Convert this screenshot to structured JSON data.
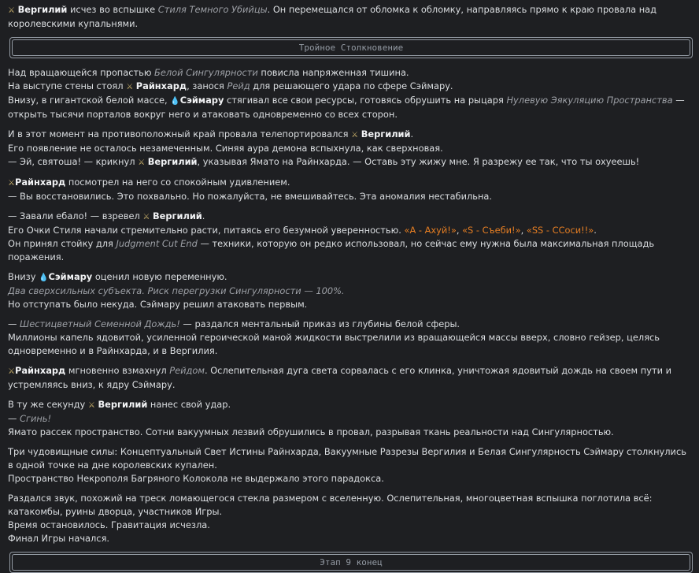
{
  "p0": {
    "vergil": "Вергилий",
    "t1": " исчез во вспышке ",
    "style": "Стиля Темного Убийцы",
    "t2": ". Он перемещался от обломка к обломку, направляясь прямо к краю провала над королевскими купальнями."
  },
  "banner1": "Тройное Столкновение",
  "p1": {
    "a1": "Над вращающейся пропастью ",
    "white": "Белой Сингулярности",
    "a2": " повисла напряженная тишина.",
    "b1": "На выступе стены стоял ",
    "rein": "Райнхард",
    "b2": ", занося ",
    "reid": "Рейд",
    "b3": " для решающего удара по сфере Сэймару.",
    "c1": "Внизу, в гигантской белой массе, ",
    "seimaru": "Сэймару",
    "c2": " стягивал все свои ресурсы, готовясь обрушить на рыцаря ",
    "zero": "Нулевую Эякуляцию Пространства",
    "c3": " — открыть тысячи порталов вокруг него и атаковать одновременно со всех сторон."
  },
  "p2": {
    "a1": "И в этот момент на противоположный край провала телепортировался ",
    "vergil": "Вергилий",
    "a2": ".",
    "b": "Его появление не осталось незамеченным. Синяя аура демона вспыхнула, как сверхновая.",
    "c1": "— Эй, святоша! — крикнул ",
    "vergil2": "Вергилий",
    "c2": ", указывая Ямато на Райнхарда. — Оставь эту жижу мне. Я разрежу ее так, что ты охуеешь!"
  },
  "p3": {
    "rein": "Райнхард",
    "a": " посмотрел на него со спокойным удивлением.",
    "b": "— Вы восстановились. Это похвально. Но пожалуйста, не вмешивайтесь. Эта аномалия нестабильна."
  },
  "p4": {
    "a1": "— Завали ебало! — взревел ",
    "vergil": "Вергилий",
    "a2": ".",
    "b1": "Его Очки Стиля начали стремительно расти, питаясь его безумной уверенностью. ",
    "r1": "«A - Ахуй!»",
    "sep1": ", ",
    "r2": "«S - Съеби!»",
    "sep2": ", ",
    "r3": "«SS - ССоси!!»",
    "b2": ".",
    "c1": "Он принял стойку для ",
    "jce": "Judgment Cut End",
    "c2": " — техники, которую он редко использовал, но сейчас ему нужна была максимальная площадь поражения."
  },
  "p5": {
    "a1": "Внизу ",
    "seimaru": "Сэймару",
    "a2": " оценил новую переменную.",
    "b": "Два сверхсильных субъекта. Риск перегрузки Сингулярности — 100%.",
    "c": "Но отступать было некуда. Сэймару решил атаковать первым."
  },
  "p6": {
    "a1": "— ",
    "rain": "Шестицветный Семенной Дождь!",
    "a2": " — раздался ментальный приказ из глубины белой сферы.",
    "b": "Миллионы капель ядовитой, усиленной героической маной жидкости выстрелили из вращающейся массы вверх, словно гейзер, целясь одновременно и в Райнхарда, и в Вергилия."
  },
  "p7": {
    "rein": "Райнхард",
    "a1": " мгновенно взмахнул ",
    "reid": "Рейдом",
    "a2": ". Ослепительная дуга света сорвалась с его клинка, уничтожая ядовитый дождь на своем пути и устремляясь вниз, к ядру Сэймару."
  },
  "p8": {
    "a1": "В ту же секунду ",
    "vergil": "Вергилий",
    "a2": " нанес свой удар.",
    "b1": "— ",
    "die": "Сгинь!",
    "c": "Ямато рассек пространство. Сотни вакуумных лезвий обрушились в провал, разрывая ткань реальности над Сингулярностью."
  },
  "p9": {
    "a": "Три чудовищные силы: Концептуальный Свет Истины Райнхарда, Вакуумные Разрезы Вергилия и Белая Сингулярность Сэймару столкнулись в одной точке на дне королевских купален.",
    "b": "Пространство Некрополя Багряного Колокола не выдержало этого парадокса."
  },
  "p10": {
    "a": "Раздался звук, похожий на треск ломающегося стекла размером с вселенную. Ослепительная, многоцветная вспышка поглотила всё: катакомбы, руины дворца, участников Игры.",
    "b": "Время остановилось. Гравитация исчезла.",
    "c": "Финал Игры начался."
  },
  "banner2": "Этап 9 конец"
}
